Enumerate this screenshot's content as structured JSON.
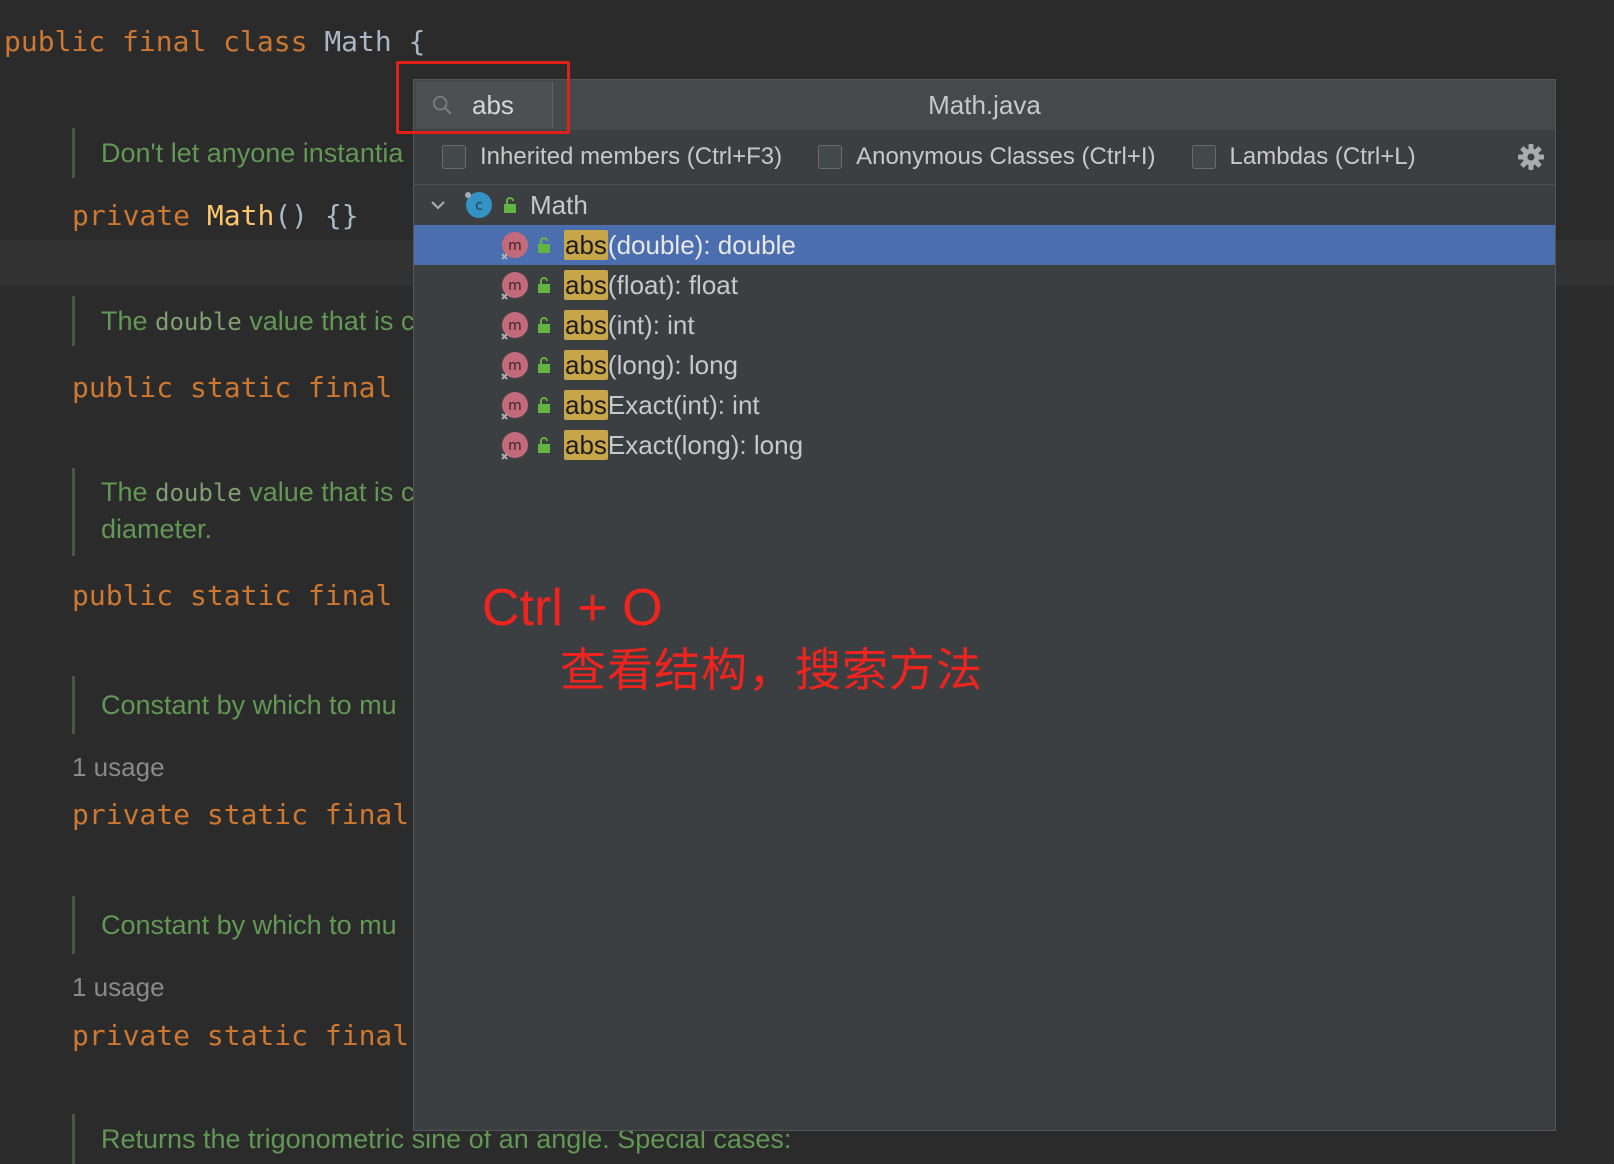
{
  "editor": {
    "class_decl": {
      "kw1": "public",
      "kw2": "final",
      "kw3": "class",
      "name": "Math",
      "brace": "{"
    },
    "doc1": "Don't let anyone instantia",
    "ctor": {
      "kw": "private",
      "name": "Math",
      "rest": "() {}"
    },
    "doc2_pre": "The ",
    "doc2_code": "double",
    "doc2_post": " value that is c",
    "field1": "public static final",
    "doc3_pre": "The ",
    "doc3_code": "double",
    "doc3_post": " value that is c",
    "doc3_line2": "diameter.",
    "field2": "public static final",
    "doc4": "Constant by which to mu",
    "usage1": "1 usage",
    "field3": "private static final",
    "doc5": "Constant by which to mu",
    "usage2": "1 usage",
    "field4": "private static final",
    "doc6": "Returns the trigonometric sine of an angle. Special cases:"
  },
  "popup": {
    "search_value": "abs",
    "title": "Math.java",
    "options": [
      {
        "label": "Inherited members (Ctrl+F3)"
      },
      {
        "label": "Anonymous Classes (Ctrl+I)"
      },
      {
        "label": "Lambdas (Ctrl+L)"
      }
    ],
    "root": {
      "label": "Math"
    },
    "items": [
      {
        "match": "abs",
        "rest": "(double): double"
      },
      {
        "match": "abs",
        "rest": "(float): float"
      },
      {
        "match": "abs",
        "rest": "(int): int"
      },
      {
        "match": "abs",
        "rest": "(long): long"
      },
      {
        "match": "abs",
        "rest": "Exact(int): int"
      },
      {
        "match": "abs",
        "rest": "Exact(long): long"
      }
    ]
  },
  "annotation": {
    "shortcut": "Ctrl + O",
    "description": "查看结构，搜索方法"
  },
  "colors": {
    "selected_row": "#4b6eaf",
    "match_highlight": "#c9a54a",
    "annotation_red": "#f0241f"
  }
}
